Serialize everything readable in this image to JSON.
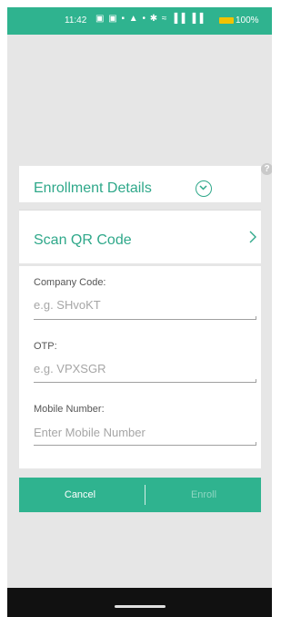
{
  "status_bar": {
    "time": "11:42",
    "icons": "▣ ▣ ▪ ▲ • ✱ ≈ ▐▐ ▐▐",
    "battery": "100%"
  },
  "dialog": {
    "help_icon": "?",
    "title": "Enrollment Details",
    "scan_label": "Scan QR Code",
    "fields": {
      "company_code": {
        "label": "Company Code:",
        "placeholder": "e.g. SHvoKT",
        "value": ""
      },
      "otp": {
        "label": "OTP:",
        "placeholder": "e.g. VPXSGR",
        "value": ""
      },
      "mobile": {
        "label": "Mobile Number:",
        "placeholder": "Enter Mobile Number",
        "value": ""
      }
    },
    "cancel_label": "Cancel",
    "enroll_label": "Enroll"
  },
  "colors": {
    "accent": "#2fb38f",
    "title_text": "#2fa88a",
    "disabled_text": "#8fd6c2"
  },
  "icons": [
    "help-icon",
    "chevron-down-circle-icon",
    "chevron-right-icon",
    "battery-icon"
  ]
}
